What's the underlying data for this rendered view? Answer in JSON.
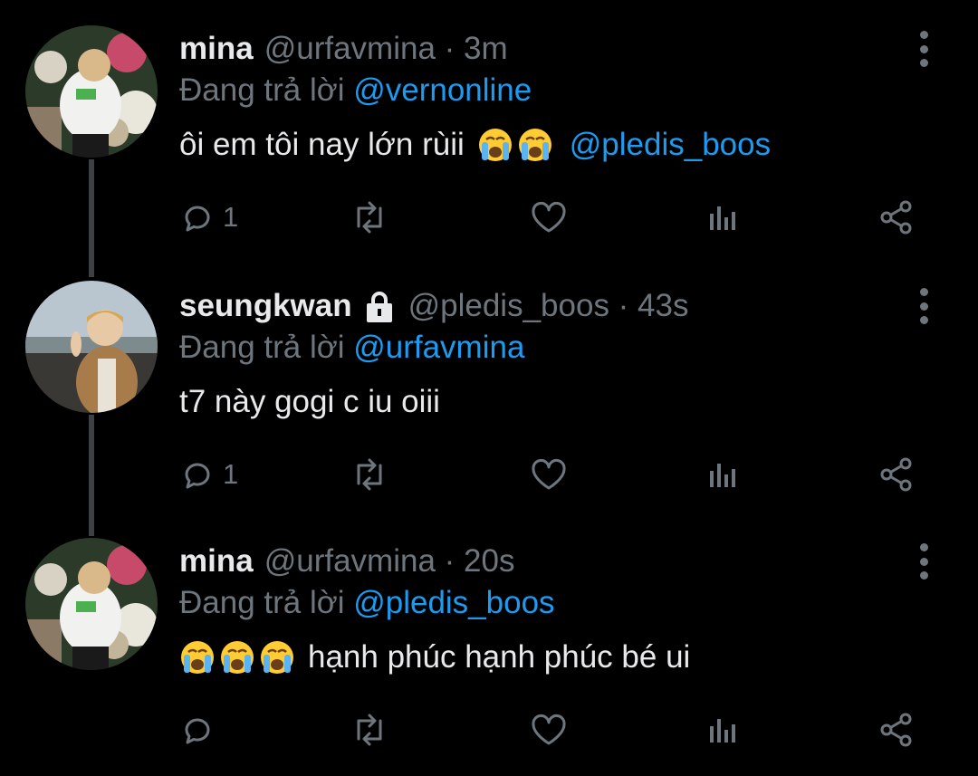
{
  "tweets": [
    {
      "name": "mina",
      "handle": "@urfavmina · 3m",
      "reply_prefix": "Đang trả lời",
      "reply_mention": "@vernonline",
      "text": "ôi em tôi nay lớn rùii",
      "emojis": [
        "loudly-crying-face",
        "loudly-crying-face"
      ],
      "mention": "@pledis_boos",
      "reply_count": "1"
    },
    {
      "name": "seungkwan",
      "protected_icon": "lock-icon",
      "handle": "@pledis_boos · 43s",
      "reply_prefix": "Đang trả lời",
      "reply_mention": "@urfavmina",
      "text": "t7 này gogi c iu oiii",
      "reply_count": "1"
    },
    {
      "name": "mina",
      "handle": "@urfavmina · 20s",
      "reply_prefix": "Đang trả lời",
      "reply_mention": "@pledis_boos",
      "text": "hạnh phúc hạnh phúc bé ui",
      "emojis": [
        "loudly-crying-face",
        "loudly-crying-face",
        "loudly-crying-face"
      ]
    }
  ],
  "colors": {
    "background": "#000000",
    "text": "#e7e9ea",
    "muted": "#6e767d",
    "accent": "#1d9bf0",
    "thread_line": "#3e4144"
  }
}
